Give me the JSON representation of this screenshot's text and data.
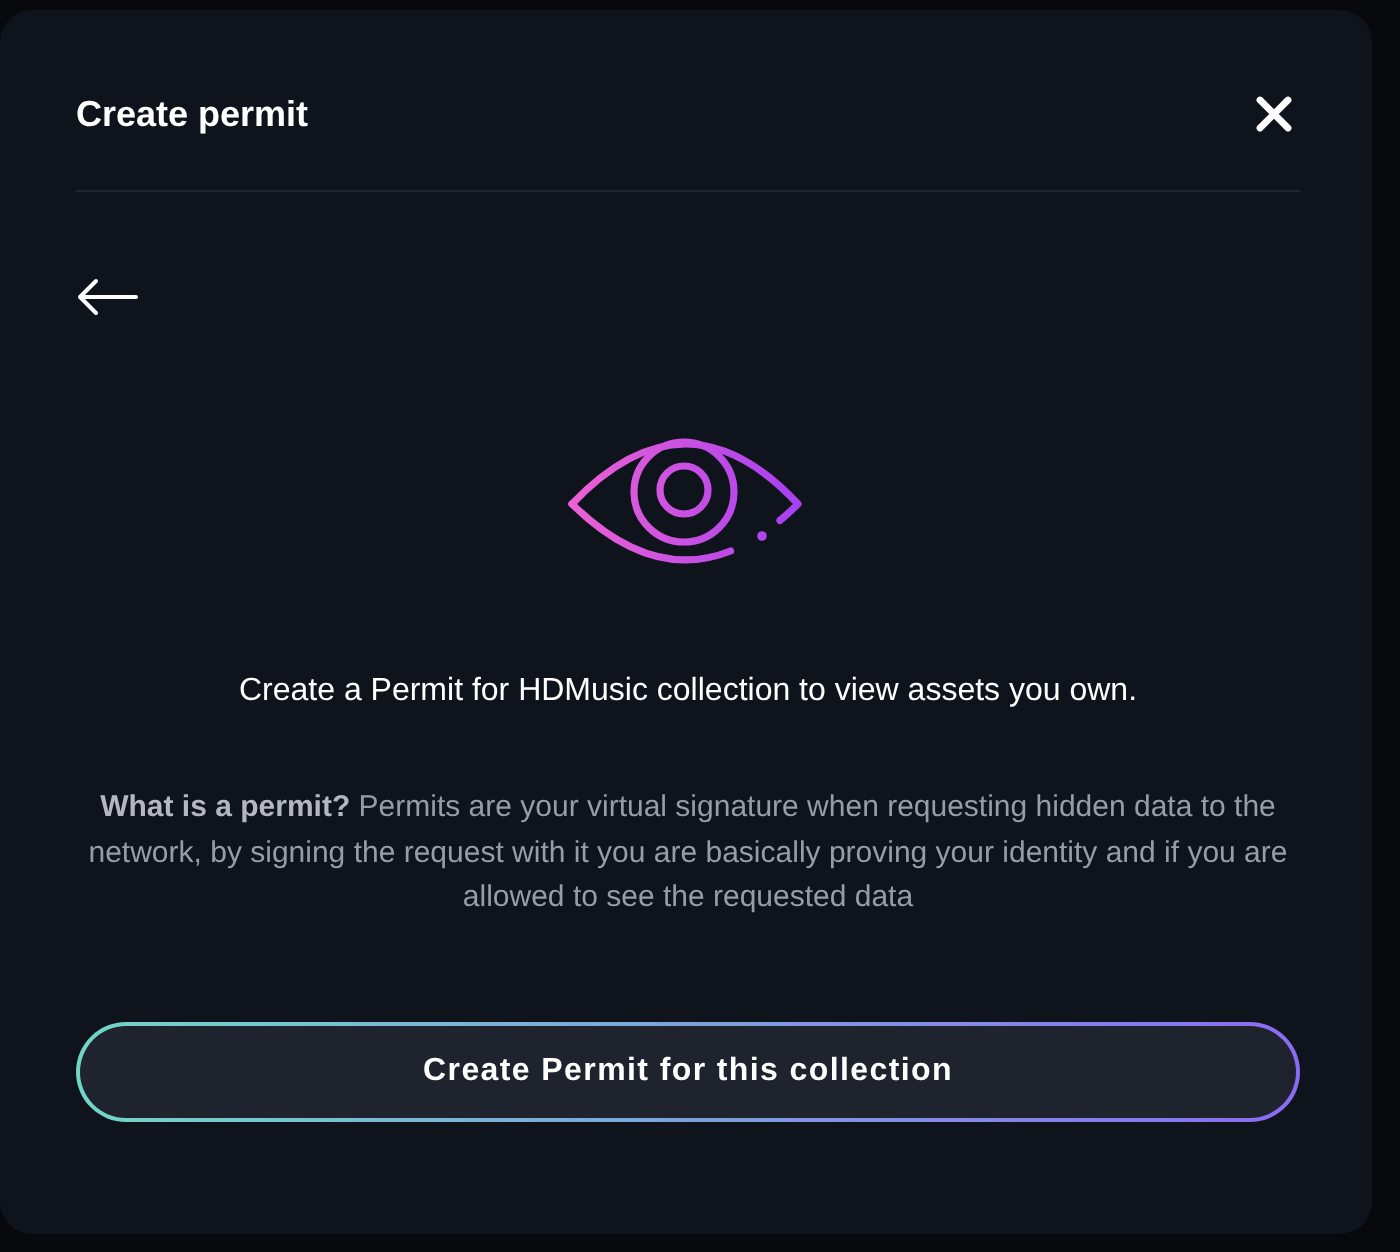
{
  "dialog": {
    "title": "Create permit"
  },
  "content": {
    "headline": "Create a Permit for HDMusic collection to view assets you own.",
    "description": "**What is a permit?** Permits are your virtual signature when requesting hidden data to the network, by signing the request with it you are basically proving your identity and if you are allowed to see the requested data"
  },
  "primary_button": {
    "label": "Create Permit for this collection"
  }
}
